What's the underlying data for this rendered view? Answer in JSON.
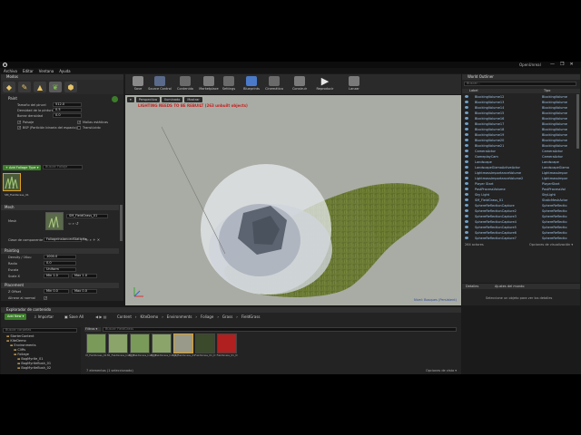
{
  "window": {
    "project_name": "OpenUnreal",
    "menu": [
      "Archivo",
      "Editar",
      "Ventana",
      "Ayuda"
    ],
    "buttons": [
      "—",
      "❐",
      "✕"
    ]
  },
  "modes_panel": {
    "tab_label": "Modos",
    "mode_name": "Paint",
    "settings": [
      {
        "label": "Tamaño del pincel",
        "value": "512.0"
      },
      {
        "label": "Densidad de la pintura",
        "value": "0.5"
      },
      {
        "label": "Borrar densidad",
        "value": "0.0"
      }
    ],
    "checkboxes": [
      {
        "label": "Paisaje",
        "checked": true
      },
      {
        "label": "Mallas estáticas",
        "checked": true
      },
      {
        "label": "BSP (Partición binaria del espacio)",
        "checked": true
      },
      {
        "label": "Translúcido",
        "checked": false
      }
    ],
    "add_foliage_btn": "+ Add Foliage Type ▾",
    "search_placeholder": "Buscar Follaje",
    "foliage_item": "SM_FieldGrass_01",
    "mesh_section": "Mesh",
    "mesh_label": "Mesh",
    "mesh_value": "SM_FieldGrass_01",
    "component_label": "Clase de componente",
    "component_value": "FoliageInstancedStaticMe",
    "painting_section": "Painting",
    "painting_rows": [
      {
        "label": "Density / 1Kuu",
        "value": "1000.0"
      },
      {
        "label": "Radio",
        "value": "0.0"
      },
      {
        "label": "Escala",
        "value": "Uniform"
      },
      {
        "label": "Scale X",
        "min": "Min 1.0",
        "max": "Max 1.0"
      }
    ],
    "placement_section": "Placement",
    "placement_rows": [
      {
        "label": "Z Offset",
        "min": "Min 0.0",
        "max": "Max 0.0"
      },
      {
        "label": "Alinear al normal",
        "value": ""
      }
    ]
  },
  "toolbar": {
    "buttons": [
      {
        "label": "Save",
        "color": "#8a8a8a"
      },
      {
        "label": "Source Control",
        "color": "#5a6a8a"
      },
      {
        "label": "Contenido",
        "color": "#6a6a6a"
      },
      {
        "label": "Marketplace",
        "color": "#7a7a7a"
      },
      {
        "label": "Settings",
        "color": "#6a6a6a"
      },
      {
        "label": "Blueprints",
        "color": "#4a7ac8"
      },
      {
        "label": "Cinemática",
        "color": "#6a6a6a"
      },
      {
        "label": "Construir",
        "color": "#7a7a7a"
      },
      {
        "label": "Reproducir",
        "color": "#cfcfcf"
      },
      {
        "label": "Lanzar",
        "color": "#7a7a7a"
      }
    ]
  },
  "viewport": {
    "buttons": [
      "▾",
      "Perspectiva",
      "Iluminado",
      "Mostrar"
    ],
    "warning": "LIGHTING NEEDS TO BE REBUILT (263 unbuilt objects)",
    "level_label": "Nivel:  Bosques (Persistent)"
  },
  "outliner": {
    "tab_label": "World Outliner",
    "search_placeholder": "Buscar...",
    "col_label": "Label",
    "col_type": "Tipo",
    "rows": [
      {
        "label": "BlockingVolume12",
        "type": "BlockingVolume"
      },
      {
        "label": "BlockingVolume13",
        "type": "BlockingVolume"
      },
      {
        "label": "BlockingVolume14",
        "type": "BlockingVolume"
      },
      {
        "label": "BlockingVolume15",
        "type": "BlockingVolume"
      },
      {
        "label": "BlockingVolume16",
        "type": "BlockingVolume"
      },
      {
        "label": "BlockingVolume17",
        "type": "BlockingVolume"
      },
      {
        "label": "BlockingVolume18",
        "type": "BlockingVolume"
      },
      {
        "label": "BlockingVolume19",
        "type": "BlockingVolume"
      },
      {
        "label": "BlockingVolume20",
        "type": "BlockingVolume"
      },
      {
        "label": "BlockingVolume21",
        "type": "BlockingVolume"
      },
      {
        "label": "CameraActor",
        "type": "CameraActor"
      },
      {
        "label": "GameplayCam",
        "type": "CameraActor"
      },
      {
        "label": "Landscape",
        "type": "Landscape"
      },
      {
        "label": "LandscapeGizmoActiveActor",
        "type": "LandscapeGizmo"
      },
      {
        "label": "LightmassImportanceVolume",
        "type": "LightmassImpor"
      },
      {
        "label": "LightmassImportanceVolume2",
        "type": "LightmassImpor"
      },
      {
        "label": "Player Start",
        "type": "PlayerStart"
      },
      {
        "label": "PostProcessVolume",
        "type": "PostProcessVol"
      },
      {
        "label": "Sky Light",
        "type": "SkyLight"
      },
      {
        "label": "SM_FieldGrass_01",
        "type": "StaticMeshActor"
      },
      {
        "label": "SphereReflectionCapture",
        "type": "SphereReflectio"
      },
      {
        "label": "SphereReflectionCapture2",
        "type": "SphereReflectio"
      },
      {
        "label": "SphereReflectionCapture3",
        "type": "SphereReflectio"
      },
      {
        "label": "SphereReflectionCapture4",
        "type": "SphereReflectio"
      },
      {
        "label": "SphereReflectionCapture5",
        "type": "SphereReflectio"
      },
      {
        "label": "SphereReflectionCapture6",
        "type": "SphereReflectio"
      },
      {
        "label": "SphereReflectionCapture7",
        "type": "SphereReflectio"
      }
    ],
    "actor_count": "264 actores",
    "view_options": "Opciones de visualización ▾"
  },
  "details": {
    "tabs": [
      "Detalles",
      "Ajustes del mundo"
    ],
    "hint": "Seleccione un objeto para ver los detalles"
  },
  "content_browser": {
    "tab_label": "Explorador de contenido",
    "add_new": "Add New ▾",
    "import": "Importar",
    "save_all": "Save All",
    "path": [
      "Content",
      "KiteDemo",
      "Environments",
      "Foliage",
      "Grass",
      "FieldGrass"
    ],
    "filter_label": "Filtros ▾",
    "search_placeholder": "Buscar FieldGrass",
    "search_folders_placeholder": "Buscar carpetas",
    "tree": [
      {
        "label": "StarterContent",
        "depth": 1
      },
      {
        "label": "KiteDemo",
        "depth": 1
      },
      {
        "label": "Environments",
        "depth": 2
      },
      {
        "label": "Cliffs",
        "depth": 3
      },
      {
        "label": "Foliage",
        "depth": 3
      },
      {
        "label": "BogMyrtle_01",
        "depth": 4
      },
      {
        "label": "BogMyrtleBush_01",
        "depth": 4
      },
      {
        "label": "BogMyrtleBush_02",
        "depth": 4
      }
    ],
    "assets": [
      {
        "caption": "M_FieldGrass_01",
        "color": "#7a9a5a"
      },
      {
        "caption": "MI_FieldGrass_Inst_01",
        "color": "#8aa46a"
      },
      {
        "caption": "MI_FieldGrass_Inst_02",
        "color": "#7a9a5a"
      },
      {
        "caption": "MI_FieldGrass_Inst_03",
        "color": "#8aa46a"
      },
      {
        "caption": "SM_FieldGrass_01",
        "color": "#9a9a8a"
      },
      {
        "caption": "FieldGrass_01_D",
        "color": "#3a4a2a"
      },
      {
        "caption": "FieldGrass_01_N",
        "color": "#b02020"
      }
    ],
    "item_count": "7 elementos (1 seleccionado)",
    "view_options": "Opciones de vista ▾"
  }
}
